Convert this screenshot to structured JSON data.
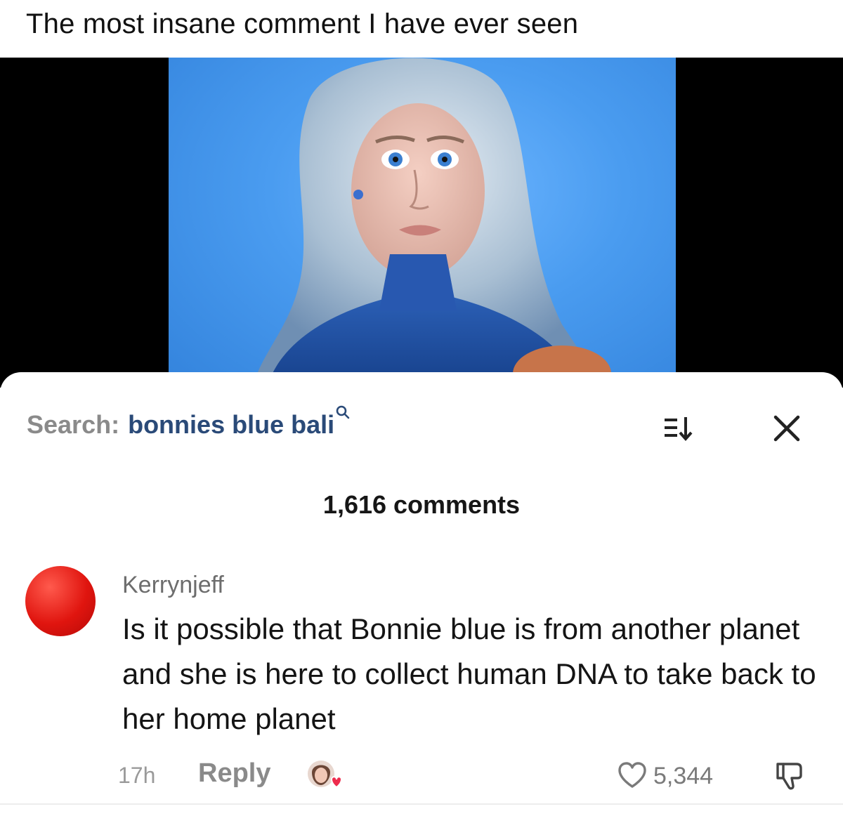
{
  "caption": "The most insane comment I have ever seen",
  "colors": {
    "video_bg": "#4a9cf0",
    "search_query": "#2a4a78",
    "avatar": "#e0150f"
  },
  "search": {
    "prefix": "Search:",
    "query": "bonnies blue bali",
    "icon": "search-icon"
  },
  "toolbar": {
    "sort_icon": "sort-icon",
    "close_icon": "close-icon"
  },
  "comments": {
    "count_label": "1,616 comments",
    "items": [
      {
        "username": "Kerrynjeff",
        "text": "Is it possible that Bonnie blue is from another planet and she is here to collect human DNA to take back to her home planet",
        "time": "17h",
        "reply_label": "Reply",
        "likes": "5,344"
      }
    ]
  }
}
